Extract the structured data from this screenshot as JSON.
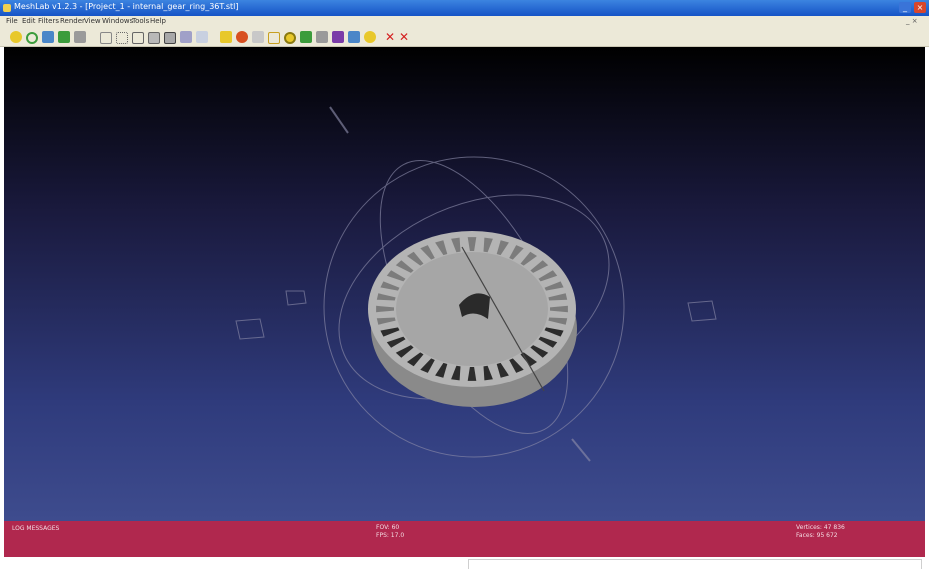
{
  "window": {
    "title": "MeshLab v1.2.3 - [Project_1 - internal_gear_ring_36T.stl]",
    "minimize_glyph": "_",
    "close_glyph": "×"
  },
  "menu": [
    "File",
    "Edit",
    "Filters",
    "Render",
    "View",
    "Windows",
    "Tools",
    "Help"
  ],
  "mdi_controls": "_ ×",
  "toolbar": {
    "icons": [
      "open-icon",
      "reload-icon",
      "save-icon",
      "snapshot-icon",
      "layers-icon",
      "bbox-icon",
      "points-icon",
      "wireframe-icon",
      "hidden-lines-icon",
      "flat-lines-icon",
      "flat-icon",
      "smooth-icon",
      "texture-icon",
      "lighting-icon",
      "double-side-icon",
      "select-faces-icon",
      "select-vertices-icon",
      "measure-icon",
      "align-icon",
      "paint-icon",
      "rotate-icon",
      "info-icon",
      "delete-icon",
      "delete-vertices-icon"
    ],
    "colors": {
      "yellow": "#e8c82a",
      "green": "#3c9c3c",
      "blue": "#4a86c8",
      "purple": "#7a3ca8",
      "red": "#d42020",
      "gray": "#9a9a9a"
    }
  },
  "viewport": {
    "background_top": "#000000",
    "background_bottom": "#3e4c8e",
    "model_color": "#a8a8a8",
    "trackball_color": "#8a8aa8"
  },
  "info_bar": {
    "left": "LOG MESSAGES",
    "center_line1": "FOV: 60",
    "center_line2": "FPS: 17.0",
    "right_line1": "Vertices: 47 836",
    "right_line2": "Faces: 95 672"
  }
}
